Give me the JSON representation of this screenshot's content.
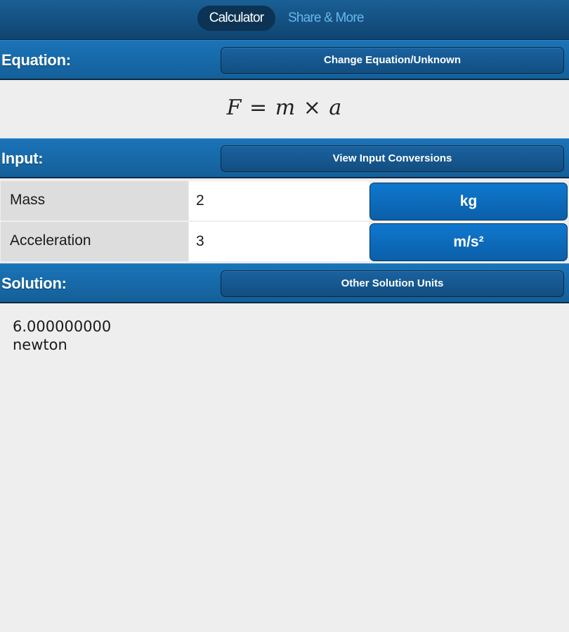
{
  "tabs": [
    {
      "label": "Calculator",
      "active": true
    },
    {
      "label": "Share & More",
      "active": false
    }
  ],
  "equation_section": {
    "label": "Equation:",
    "button": "Change Equation/Unknown",
    "formula": {
      "lhs": "F",
      "eq": "=",
      "term1": "m",
      "op": "×",
      "term2": "a"
    }
  },
  "input_section": {
    "label": "Input:",
    "button": "View Input Conversions",
    "rows": [
      {
        "label": "Mass",
        "value": "2",
        "unit": "kg"
      },
      {
        "label": "Acceleration",
        "value": "3",
        "unit": "m/s²"
      }
    ]
  },
  "solution_section": {
    "label": "Solution:",
    "button": "Other Solution Units",
    "value": "6.000000000",
    "unit": "newton"
  },
  "colors": {
    "header_dark": "#0f4470",
    "section_blue": "#1a74b8",
    "unit_button_blue": "#0f78cf",
    "inactive_tab_text": "#66b7ec",
    "background": "#eeeeee"
  }
}
